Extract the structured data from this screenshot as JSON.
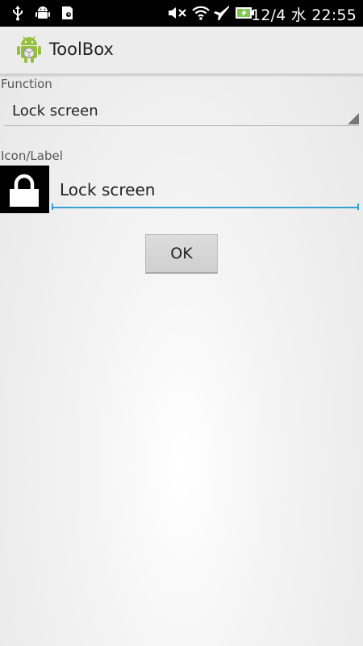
{
  "status_bar": {
    "time": "12/4 水 22:55",
    "icons": [
      "usb-icon",
      "android-debug-icon",
      "sd-card-icon",
      "mute-icon",
      "wifi-icon",
      "airplane-mode-icon",
      "battery-charging-icon"
    ],
    "battery_color": "#7ec850"
  },
  "action_bar": {
    "title": "ToolBox",
    "icon": "android-app-icon"
  },
  "function": {
    "label": "Function",
    "selected": "Lock screen"
  },
  "icon_label": {
    "label": "Icon/Label",
    "icon": "lock-icon",
    "value": "Lock screen"
  },
  "ok_button": {
    "label": "OK"
  },
  "colors": {
    "accent": "#33a0d6",
    "status_bar_bg": "#000000",
    "action_bar_bg": "#ececec"
  }
}
